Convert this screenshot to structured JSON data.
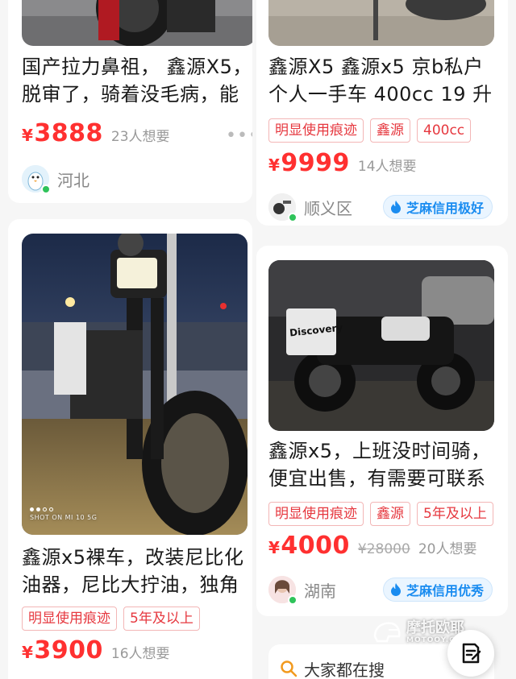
{
  "listings": [
    {
      "title_lines": [
        "国产拉力鼻祖，  鑫源X5，",
        "脱审了，骑着没毛病，能"
      ],
      "price": "3888",
      "currency": "¥",
      "want": "23人想要",
      "more": "•••",
      "location": "河北"
    },
    {
      "title_lines": [
        "鑫源X5 鑫源x5 京b私户",
        "个人一手车 400cc  19 升"
      ],
      "tags": [
        "明显使用痕迹",
        "鑫源",
        "400cc"
      ],
      "price": "9999",
      "currency": "¥",
      "want": "14人想要",
      "location": "顺义区",
      "credit": "芝麻信用极好"
    },
    {
      "image_overlay": "SHOT ON MI 10 5G",
      "title_lines": [
        "鑫源x5裸车，改装尼比化",
        "油器，尼比大拧油，独角"
      ],
      "tags": [
        "明显使用痕迹",
        "5年及以上"
      ],
      "price": "3900",
      "currency": "¥",
      "want": "16人想要"
    },
    {
      "image_text": "Discovery",
      "title_lines": [
        "鑫源x5，上班没时间骑，",
        "便宜出售，有需要可联系"
      ],
      "tags": [
        "明显使用痕迹",
        "鑫源",
        "5年及以上"
      ],
      "price": "4000",
      "currency": "¥",
      "original_price": "¥28000",
      "want": "20人想要",
      "location": "湖南",
      "credit": "芝麻信用优秀"
    }
  ],
  "search": {
    "placeholder": "大家都在搜"
  },
  "watermark": {
    "line1": "摩托欧耶",
    "line2": "MOTOOY.COM"
  },
  "colors": {
    "price": "#ff3030",
    "tag": "#e6383f",
    "credit": "#1a8cf0",
    "online": "#2fc35a"
  }
}
